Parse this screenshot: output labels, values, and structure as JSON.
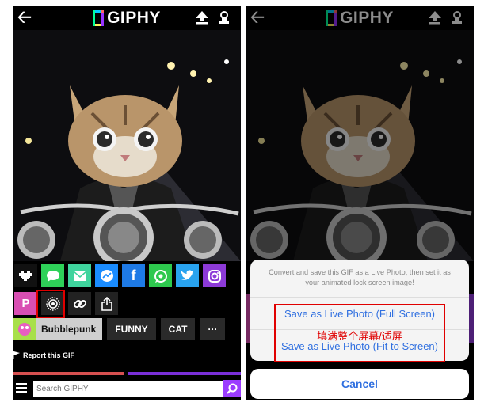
{
  "app": {
    "logo_text": "GIPHY"
  },
  "share_buttons": [
    {
      "name": "pixel-heart",
      "color": "#111111"
    },
    {
      "name": "imessage",
      "color": "#2ed158"
    },
    {
      "name": "email",
      "color": "#3fd49d"
    },
    {
      "name": "messenger",
      "color": "#1a8cff"
    },
    {
      "name": "facebook",
      "color": "#1e7ae6"
    },
    {
      "name": "whatsapp",
      "color": "#2ec94e"
    },
    {
      "name": "twitter",
      "color": "#29a3ef"
    },
    {
      "name": "instagram",
      "color": "#8d3ad8"
    }
  ],
  "tags": {
    "primary": "Bubblepunk",
    "second": "FUNNY",
    "third": "CAT",
    "more": "···"
  },
  "report_label": "Report this GIF",
  "search": {
    "placeholder": "Search GIPHY"
  },
  "dialog": {
    "message": "Convert and save this GIF as a Live Photo, then set it as your animated lock screen image!",
    "option_full": "Save as Live Photo (Full Screen)",
    "option_fit": "Save as Live Photo (Fit to Screen)",
    "annotation_cn": "填满整个屏幕/适屏",
    "cancel": "Cancel"
  },
  "colors": {
    "accent": "#9b3cff",
    "annotation": "#e00000",
    "ios_blue": "#2f6fe0"
  }
}
